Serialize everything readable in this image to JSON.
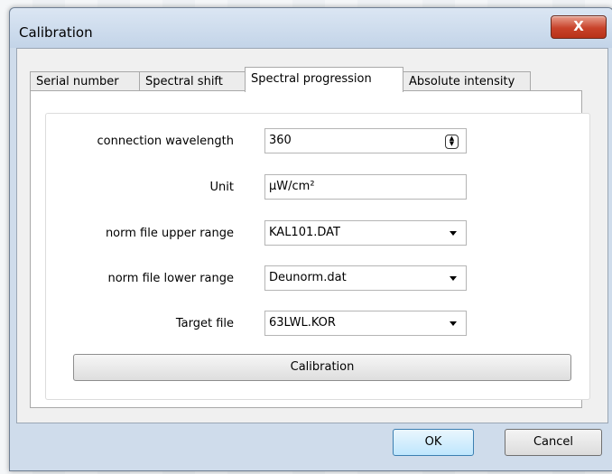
{
  "window": {
    "title": "Calibration",
    "close_glyph": "X",
    "close_icon": "close-icon"
  },
  "tabs": [
    {
      "label": "Serial number",
      "active": false
    },
    {
      "label": "Spectral shift",
      "active": false
    },
    {
      "label": "Spectral progression",
      "active": true
    },
    {
      "label": "Absolute intensity",
      "active": false
    }
  ],
  "form": {
    "connection_wavelength": {
      "label": "connection wavelength",
      "value": "360",
      "icon": "spinner-updown-icon"
    },
    "unit": {
      "label": "Unit",
      "value": "µW/cm²"
    },
    "norm_upper": {
      "label": "norm file upper range",
      "value": "KAL101.DAT",
      "icon": "chevron-down-icon"
    },
    "norm_lower": {
      "label": "norm file lower range",
      "value": "Deunorm.dat",
      "icon": "chevron-down-icon"
    },
    "target_file": {
      "label": "Target file",
      "value": "63LWL.KOR",
      "icon": "chevron-down-icon"
    }
  },
  "buttons": {
    "calibration": "Calibration",
    "ok": "OK",
    "cancel": "Cancel"
  }
}
